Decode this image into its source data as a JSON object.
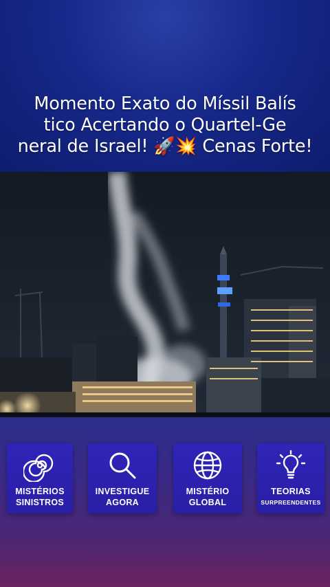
{
  "post": {
    "title": "Momento Exato do Míssil Balís\ntico Acertando o Quartel-Ge\nneral de Israel! 🚀💥 Cenas Forte!"
  },
  "video": {
    "scene": "night-city-missile-smoke"
  },
  "cards": [
    {
      "icon": "spiral-icon",
      "line1": "MISTÉRIOS",
      "line2": "SINISTROS"
    },
    {
      "icon": "magnifier-icon",
      "line1": "INVESTIGUE",
      "line2": "AGORA"
    },
    {
      "icon": "globe-icon",
      "line1": "MISTÉRIO",
      "line2": "GLOBAL"
    },
    {
      "icon": "lightbulb-icon",
      "line1": "TEORIAS",
      "line2": "SURPREENDENTES"
    }
  ],
  "colors": {
    "top_band": "#16288a",
    "card_bg": "#2e24b8",
    "bottom_gradient_end": "#6a2460"
  }
}
